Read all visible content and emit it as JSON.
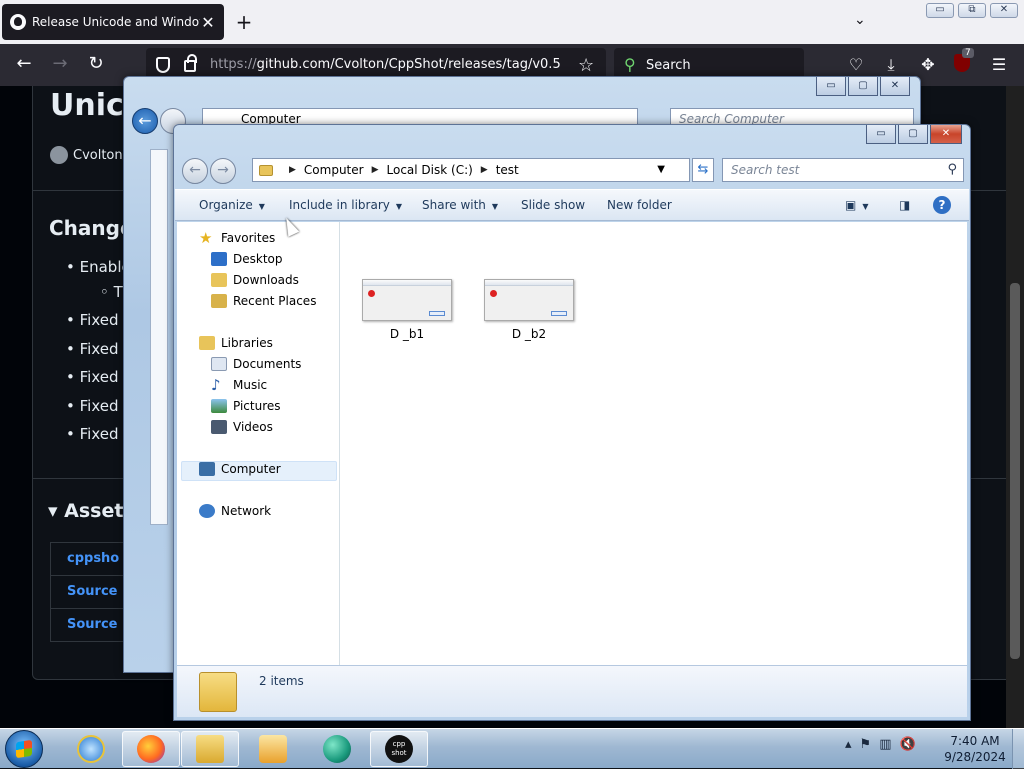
{
  "browser": {
    "tab_title": "Release Unicode and Windows",
    "tab_close": "✕",
    "new_tab": "+",
    "list_all": "⌄",
    "url_prefix": "https://",
    "url_host": "github.com",
    "url_path": "/Cvolton/CppShot/releases/tag/v0.5",
    "search_label": "Search",
    "ublock_count": "7",
    "win_minimize": "▭",
    "win_restore": "⧉",
    "win_close": "✕"
  },
  "github": {
    "title": "Unico",
    "author": "Cvolton",
    "changelog": "Changel",
    "items": [
      "Enable",
      "T",
      "Fixed",
      "Fixed",
      "Fixed",
      "Fixed",
      "Fixed"
    ],
    "assets": "Assets",
    "asset_items": [
      "cppsho",
      "Source",
      "Source"
    ]
  },
  "bg_window": {
    "address": "Computer",
    "search_placeholder": "Search Computer",
    "left_stub": "F"
  },
  "explorer": {
    "breadcrumb": [
      "Computer",
      "Local Disk (C:)",
      "test"
    ],
    "search_placeholder": "Search test",
    "commands": {
      "organize": "Organize",
      "include": "Include in library",
      "share": "Share with",
      "slideshow": "Slide show",
      "new_folder": "New folder"
    },
    "nav": {
      "favorites": "Favorites",
      "desktop": "Desktop",
      "downloads": "Downloads",
      "recent": "Recent Places",
      "libraries": "Libraries",
      "documents": "Documents",
      "music": "Music",
      "pictures": "Pictures",
      "videos": "Videos",
      "computer": "Computer",
      "network": "Network"
    },
    "files": [
      "D _b1",
      "D _b2"
    ],
    "status_count": "2 items"
  },
  "taskbar": {
    "time": "7:40 AM",
    "date": "9/28/2024",
    "cppshot_label": "cpp shot"
  },
  "colors": {
    "accent_link": "#4493f8",
    "taskbar": "#9fb8d2"
  }
}
